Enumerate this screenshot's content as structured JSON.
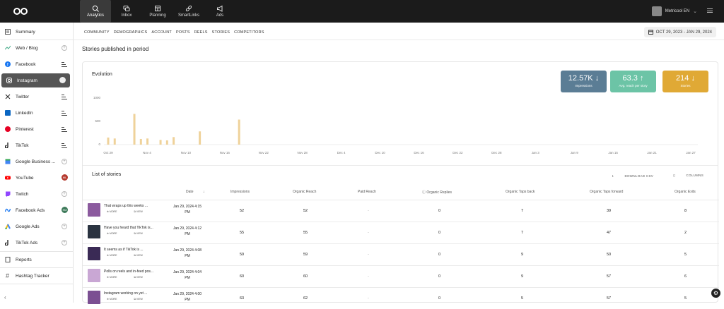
{
  "topnav": {
    "items": [
      {
        "label": "Analytics",
        "icon": "analytics-icon"
      },
      {
        "label": "Inbox",
        "icon": "inbox-icon"
      },
      {
        "label": "Planning",
        "icon": "calendar-icon"
      },
      {
        "label": "SmartLinks",
        "icon": "link-icon"
      },
      {
        "label": "Ads",
        "icon": "megaphone-icon"
      }
    ],
    "active": "Analytics",
    "account_name": "Metricool EN"
  },
  "sidebar": {
    "items": [
      {
        "label": "Summary",
        "icon": "summary-icon"
      },
      {
        "label": "Web / Blog",
        "icon": "web-icon"
      },
      {
        "label": "Facebook",
        "icon": "facebook-icon"
      },
      {
        "label": "Instagram",
        "icon": "instagram-icon"
      },
      {
        "label": "Twitter",
        "icon": "x-icon"
      },
      {
        "label": "LinkedIn",
        "icon": "linkedin-icon"
      },
      {
        "label": "Pinterest",
        "icon": "pinterest-icon"
      },
      {
        "label": "TikTok",
        "icon": "tiktok-icon"
      },
      {
        "label": "Google Business ...",
        "icon": "google-business-icon"
      },
      {
        "label": "YouTube",
        "icon": "youtube-icon"
      },
      {
        "label": "Twitch",
        "icon": "twitch-icon"
      },
      {
        "label": "Facebook Ads",
        "icon": "facebook-ads-icon"
      },
      {
        "label": "Google Ads",
        "icon": "google-ads-icon"
      },
      {
        "label": "TikTok Ads",
        "icon": "tiktok-ads-icon"
      },
      {
        "label": "Reports",
        "icon": "reports-icon"
      },
      {
        "label": "Hashtag Tracker",
        "icon": "hashtag-icon"
      }
    ],
    "active": "Instagram",
    "youtube_badge": "ML",
    "fbads_badge": "SM"
  },
  "subnav": [
    "COMMUNITY",
    "DEMOGRAPHICS",
    "ACCOUNT",
    "POSTS",
    "REELS",
    "STORIES",
    "COMPETITORS"
  ],
  "date_range": "OCT 29, 2023 - JAN 29, 2024",
  "page_title": "Stories published in period",
  "evolution": {
    "title": "Evolution",
    "kpis": [
      {
        "value": "12.57K",
        "label": "Impressions",
        "color": "#5b7d95"
      },
      {
        "value": "63.3",
        "label": "Avg. reach per story",
        "color": "#6cc4a6"
      },
      {
        "value": "214",
        "label": "Stories",
        "color": "#e0a935"
      }
    ]
  },
  "chart_data": {
    "type": "bar",
    "y_ticks": [
      "1000",
      "500",
      "0"
    ],
    "ylim": [
      0,
      1000
    ],
    "x_tick_labels": [
      "Oct 29",
      "Nov 4",
      "Nov 10",
      "Nov 16",
      "Nov 22",
      "Nov 28",
      "Dec 4",
      "Dec 10",
      "Dec 16",
      "Dec 22",
      "Dec 28",
      "Jan 3",
      "Jan 9",
      "Jan 15",
      "Jan 21",
      "Jan 27"
    ],
    "bars_color": "#efd29a",
    "line_colors": [
      "#5b7d95",
      "#6cc4a6"
    ],
    "series": [
      {
        "type": "bar",
        "values": [
          150,
          130,
          0,
          0,
          650,
          120,
          130,
          0,
          100,
          90,
          160,
          0,
          0,
          0,
          280,
          0,
          0,
          0,
          0,
          0,
          530,
          0,
          0,
          0,
          0,
          0,
          0,
          0,
          0,
          0,
          0,
          0,
          0,
          0,
          0,
          0,
          0,
          0,
          0,
          0,
          0,
          0,
          0,
          0,
          0,
          0,
          0,
          0,
          0,
          0,
          0,
          0,
          0,
          0,
          0,
          0,
          0,
          0,
          0,
          0,
          0,
          0,
          0,
          0,
          0,
          0,
          0,
          0,
          0,
          0,
          0,
          0,
          0,
          0,
          0,
          0,
          0,
          0,
          0,
          0,
          0,
          0,
          0,
          0,
          0,
          0,
          0,
          0,
          0,
          0
        ]
      },
      {
        "type": "line",
        "values": []
      },
      {
        "type": "line",
        "values": []
      }
    ]
  },
  "stories": {
    "title": "List of stories",
    "download_label": "DOWNLOAD CSV",
    "columns_label": "COLUMNS",
    "headers": [
      "Date",
      "Impressions",
      "Organic Reach",
      "Paid Reach",
      "Organic Replies",
      "Organic Taps back",
      "Organic Taps forward",
      "Organic Exits"
    ],
    "more_label": "MORE",
    "view_label": "VIEW",
    "rows": [
      {
        "text": "That wraps up this weeks ...",
        "date1": "Jan 29, 2024 4:15",
        "date2": "PM",
        "impressions": "52",
        "reach": "52",
        "paid": "-",
        "replies": "0",
        "back": "7",
        "forward": "39",
        "exits": "8",
        "thumb": "#8b5a9e"
      },
      {
        "text": "Have you heard that TikTok is...",
        "date1": "Jan 29, 2024 4:12",
        "date2": "PM",
        "impressions": "55",
        "reach": "55",
        "paid": "-",
        "replies": "0",
        "back": "7",
        "forward": "47",
        "exits": "2",
        "thumb": "#2a3340"
      },
      {
        "text": "It seems as if TikTok is ...",
        "date1": "Jan 29, 2024 4:08",
        "date2": "PM",
        "impressions": "59",
        "reach": "59",
        "paid": "-",
        "replies": "0",
        "back": "9",
        "forward": "50",
        "exits": "5",
        "thumb": "#3a2a55"
      },
      {
        "text": "Polls on reels and in-feed pos...",
        "date1": "Jan 29, 2024 4:04",
        "date2": "PM",
        "impressions": "60",
        "reach": "60",
        "paid": "-",
        "replies": "0",
        "back": "9",
        "forward": "57",
        "exits": "6",
        "thumb": "#c9a7d4"
      },
      {
        "text": "Instagram working on yet ...",
        "date1": "Jan 29, 2024 4:00",
        "date2": "PM",
        "impressions": "63",
        "reach": "62",
        "paid": "-",
        "replies": "0",
        "back": "5",
        "forward": "57",
        "exits": "5",
        "thumb": "#7b4f92"
      }
    ]
  }
}
